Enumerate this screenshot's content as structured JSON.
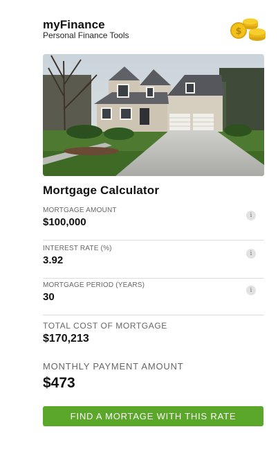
{
  "header": {
    "app_name": "myFinance",
    "tagline": "Personal Finance Tools",
    "icon": "coins-icon"
  },
  "hero": {
    "image": "house-photo"
  },
  "calculator": {
    "title": "Mortgage Calculator",
    "fields": [
      {
        "label": "MORTGAGE AMOUNT",
        "value": "$100,000",
        "info_icon": "info-icon"
      },
      {
        "label": "INTEREST RATE (%)",
        "value": "3.92",
        "info_icon": "info-icon"
      },
      {
        "label": "MORTGAGE PERIOD (YEARS)",
        "value": "30",
        "info_icon": "info-icon"
      }
    ],
    "total_cost": {
      "label": "TOTAL COST OF MORTGAGE",
      "value": "$170,213"
    },
    "monthly_payment": {
      "label": "MONTHLY PAYMENT AMOUNT",
      "value": "$473"
    },
    "cta_label": "FIND A MORTAGE WITH THIS RATE"
  },
  "colors": {
    "accent": "#5aa729",
    "coin": "#f2c21b"
  }
}
